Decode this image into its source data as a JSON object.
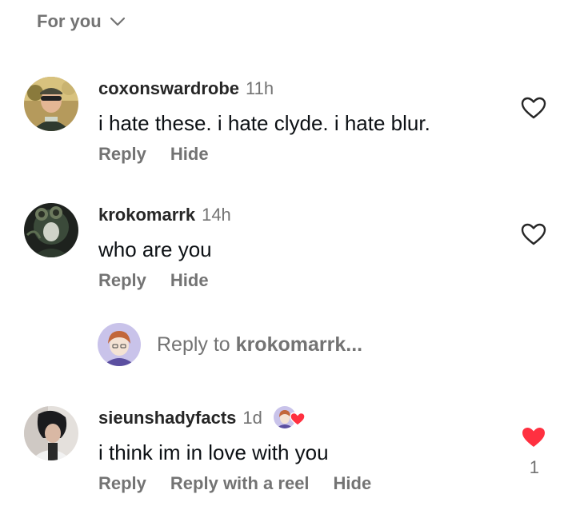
{
  "filter": {
    "label": "For you"
  },
  "comments": [
    {
      "username": "coxonswardrobe",
      "time": "11h",
      "text": "i hate these. i hate clyde. i hate blur.",
      "actions": [
        "Reply",
        "Hide"
      ],
      "liked": false
    },
    {
      "username": "krokomarrk",
      "time": "14h",
      "text": "who are you",
      "actions": [
        "Reply",
        "Hide"
      ],
      "liked": false
    },
    {
      "username": "sieunshadyfacts",
      "time": "1d",
      "text": "i think im in love with you",
      "actions": [
        "Reply",
        "Reply with a reel",
        "Hide"
      ],
      "liked": true,
      "like_count": "1"
    }
  ],
  "reply_box": {
    "prefix": "Reply to ",
    "target": "krokomarrk..."
  },
  "colors": {
    "like_red": "#ff3040",
    "muted_text": "#737373"
  },
  "icons": {
    "filter_chevron": "chevron-down-icon",
    "like_outline": "heart-outline-icon",
    "like_filled": "heart-filled-icon"
  }
}
